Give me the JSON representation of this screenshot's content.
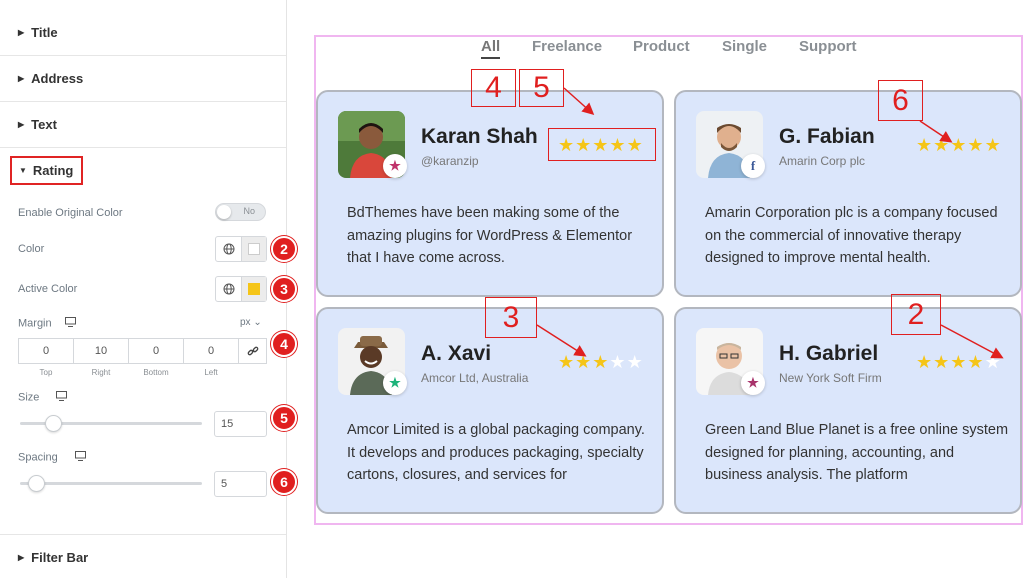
{
  "panel": {
    "sections_top": [
      {
        "label": "Title"
      },
      {
        "label": "Address"
      },
      {
        "label": "Text"
      }
    ],
    "rating": {
      "label": "Rating",
      "enable_original_color_label": "Enable Original Color",
      "toggle_text": "No",
      "color_label": "Color",
      "active_color_label": "Active Color",
      "active_color_value": "#f5c518",
      "margin_label": "Margin",
      "margin_unit": "px",
      "margin_values": [
        "0",
        "10",
        "0",
        "0"
      ],
      "margin_sides": [
        "Top",
        "Right",
        "Bottom",
        "Left"
      ],
      "size_label": "Size",
      "size_value": "15",
      "size_slider_fraction": 0.15,
      "spacing_label": "Spacing",
      "spacing_value": "5",
      "spacing_slider_fraction": 0.05
    },
    "filter_bar_label": "Filter Bar",
    "markers": {
      "color": "2",
      "active_color": "3",
      "margin": "4",
      "size": "5",
      "spacing": "6"
    }
  },
  "preview": {
    "tabs": [
      "All",
      "Freelance",
      "Product",
      "Single",
      "Support"
    ],
    "active_tab": "All",
    "cards": [
      {
        "name": "Karan Shah",
        "subtitle": "@karanzip",
        "rating": 5,
        "badge_icon": "star-icon",
        "badge_color": "#c0336b",
        "text": "BdThemes have been making some of the amazing plugins for WordPress & Elementor that I have come across."
      },
      {
        "name": "G. Fabian",
        "subtitle": "Amarin Corp plc",
        "rating": 5,
        "badge_icon": "facebook-icon",
        "badge_color": "#3b5998",
        "text": "Amarin Corporation plc is a company focused on the commercial of innovative therapy designed to improve mental health."
      },
      {
        "name": "A. Xavi",
        "subtitle": "Amcor Ltd, Australia",
        "rating": 3,
        "badge_icon": "star-icon",
        "badge_color": "#1db37a",
        "text": "Amcor Limited is a global packaging company. It develops and produces packaging, specialty cartons, closures, and services for"
      },
      {
        "name": "H. Gabriel",
        "subtitle": "New York Soft Firm",
        "rating": 4,
        "badge_icon": "star-icon",
        "badge_color": "#a8336b",
        "text": "Green Land Blue Planet is a free online system designed for planning, accounting, and business analysis. The platform"
      }
    ],
    "annotations": [
      "4",
      "5",
      "6",
      "3",
      "2"
    ]
  },
  "colors": {
    "star_active": "#f5c518",
    "star_inactive": "#ffffff",
    "annotation": "#e01f1f",
    "card_bg": "#dbe6fb"
  }
}
